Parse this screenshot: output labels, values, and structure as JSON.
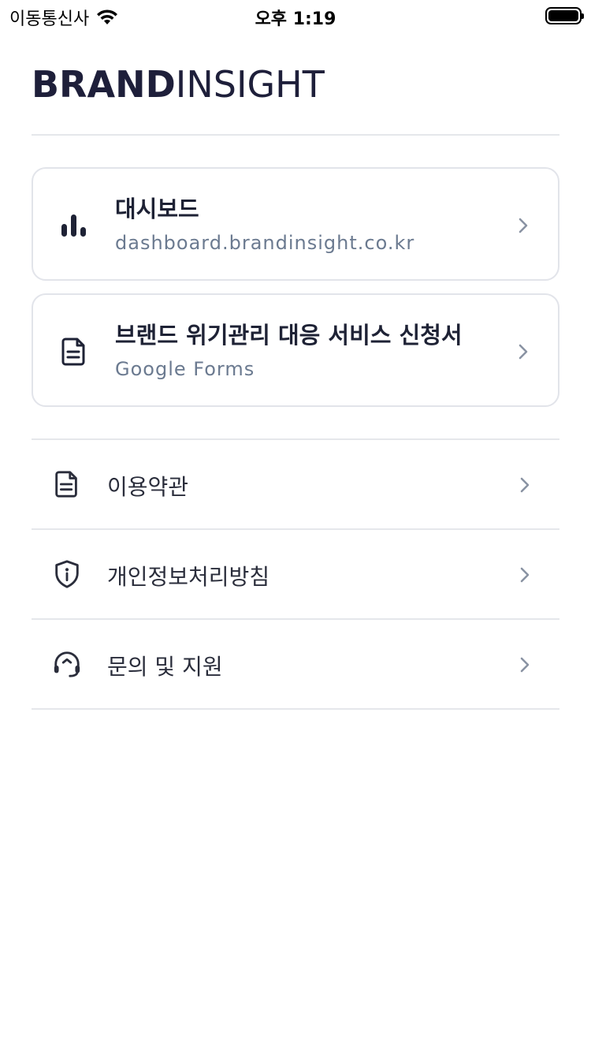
{
  "status_bar": {
    "carrier": "이동통신사",
    "time": "오후 1:19"
  },
  "header": {
    "brand_bold": "BRAND",
    "brand_light": "INSIGHT"
  },
  "cards": [
    {
      "title": "대시보드",
      "subtitle": "dashboard.brandinsight.co.kr",
      "icon": "bar-chart-icon"
    },
    {
      "title": "브랜드 위기관리 대응 서비스 신청서",
      "subtitle": "Google Forms",
      "icon": "document-icon"
    }
  ],
  "menu": [
    {
      "label": "이용약관",
      "icon": "document-icon"
    },
    {
      "label": "개인정보처리방침",
      "icon": "shield-info-icon"
    },
    {
      "label": "문의 및 지원",
      "icon": "headset-icon"
    }
  ],
  "colors": {
    "brand": "#1e1f3a",
    "subtitle": "#6b7a90",
    "divider": "#e5e7eb",
    "chevron": "#8a93a3"
  }
}
